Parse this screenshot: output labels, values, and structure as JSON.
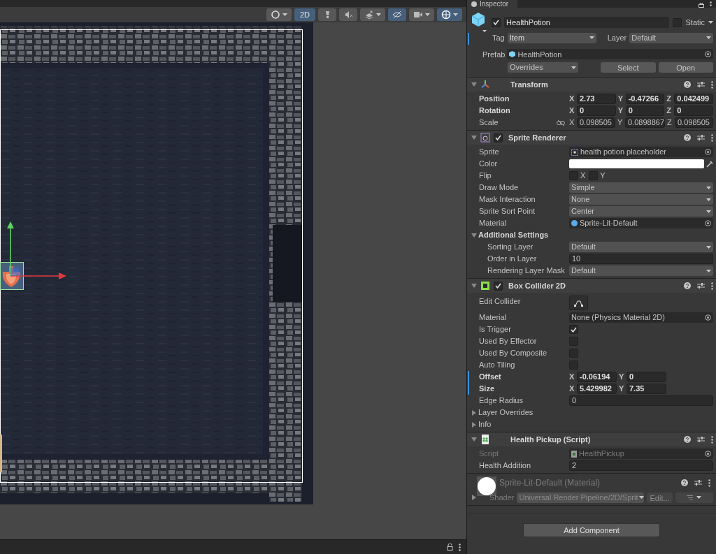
{
  "scene": {
    "toolbar": [
      {
        "kind": "shading",
        "selected": false,
        "dropdown": true
      },
      {
        "kind": "text",
        "label": "2D",
        "selected": true,
        "dropdown": false
      },
      {
        "kind": "lighting",
        "selected": false,
        "dropdown": false
      },
      {
        "kind": "audio",
        "selected": false,
        "dropdown": false
      },
      {
        "kind": "effects",
        "selected": false,
        "dropdown": true
      },
      {
        "kind": "visibility",
        "selected": true,
        "dropdown": false
      },
      {
        "kind": "camera",
        "selected": false,
        "dropdown": true
      },
      {
        "kind": "gizmos",
        "selected": true,
        "dropdown": true
      }
    ]
  },
  "inspector": {
    "tab": "Inspector",
    "object": {
      "active": true,
      "name": "HealthPotion",
      "static_label": "Static",
      "static": false,
      "tag_label": "Tag",
      "tag": "Item",
      "layer_label": "Layer",
      "layer": "Default",
      "prefab_label": "Prefab",
      "prefab": "HealthPotion",
      "overrides": "Overrides",
      "buttons": [
        "Select",
        "Open"
      ]
    },
    "components": [
      {
        "kind": "transform",
        "title": "Transform",
        "expanded": true,
        "properties": [
          {
            "kind": "vector",
            "label": "Position",
            "bold": true,
            "bar": false,
            "fields": [
              {
                "axis": "X",
                "value": "2.73"
              },
              {
                "axis": "Y",
                "value": "-0.47266"
              },
              {
                "axis": "Z",
                "value": "0.042499"
              }
            ]
          },
          {
            "kind": "vector",
            "label": "Rotation",
            "bold": true,
            "bar": false,
            "fields": [
              {
                "axis": "X",
                "value": "0"
              },
              {
                "axis": "Y",
                "value": "0"
              },
              {
                "axis": "Z",
                "value": "0"
              }
            ]
          },
          {
            "kind": "vector",
            "label": "Scale",
            "bold": false,
            "bar": false,
            "linked": true,
            "fields": [
              {
                "axis": "X",
                "value": "0.098505"
              },
              {
                "axis": "Y",
                "value": "0.0898867"
              },
              {
                "axis": "Z",
                "value": "0.098505"
              }
            ]
          }
        ]
      },
      {
        "kind": "sprite",
        "title": "Sprite Renderer",
        "enabled": true,
        "expanded": true,
        "properties": [
          {
            "kind": "sprite",
            "label": "Sprite",
            "value": "health potion placeholder"
          },
          {
            "kind": "color",
            "label": "Color"
          },
          {
            "kind": "flip",
            "label": "Flip",
            "checks": [
              {
                "axis": "X",
                "checked": false
              },
              {
                "axis": "Y",
                "checked": false
              }
            ]
          },
          {
            "kind": "dropdown",
            "label": "Draw Mode",
            "value": "Simple"
          },
          {
            "kind": "dropdown",
            "label": "Mask Interaction",
            "value": "None"
          },
          {
            "kind": "dropdown",
            "label": "Sprite Sort Point",
            "value": "Center"
          },
          {
            "kind": "material",
            "label": "Material",
            "value": "Sprite-Lit-Default"
          },
          {
            "kind": "foldout",
            "label": "Additional Settings",
            "expanded": true,
            "children": [
              {
                "kind": "dropdown",
                "label": "Sorting Layer",
                "value": "Default"
              },
              {
                "kind": "field",
                "label": "Order in Layer",
                "value": "10"
              },
              {
                "kind": "dropdown",
                "label": "Rendering Layer Mask",
                "value": "Default"
              }
            ]
          }
        ]
      },
      {
        "kind": "collider",
        "title": "Box Collider 2D",
        "enabled": true,
        "expanded": true,
        "properties": [
          {
            "kind": "button",
            "label": "Edit Collider"
          },
          {
            "kind": "object",
            "label": "Material",
            "value": "None (Physics Material 2D)"
          },
          {
            "kind": "checkbox",
            "label": "Is Trigger",
            "checked": true
          },
          {
            "kind": "checkbox",
            "label": "Used By Effector",
            "checked": false
          },
          {
            "kind": "checkbox",
            "label": "Used By Composite",
            "checked": false
          },
          {
            "kind": "checkbox",
            "label": "Auto Tiling",
            "checked": false
          },
          {
            "kind": "vector",
            "label": "Offset",
            "bold": true,
            "bar": true,
            "fields": [
              {
                "axis": "X",
                "value": "-0.06194"
              },
              {
                "axis": "Y",
                "value": "0"
              }
            ]
          },
          {
            "kind": "vector",
            "label": "Size",
            "bold": true,
            "bar": true,
            "fields": [
              {
                "axis": "X",
                "value": "5.429982"
              },
              {
                "axis": "Y",
                "value": "7.35"
              }
            ]
          },
          {
            "kind": "field",
            "label": "Edge Radius",
            "value": "0"
          },
          {
            "kind": "foldout",
            "label": "Layer Overrides",
            "expanded": false
          },
          {
            "kind": "foldout",
            "label": "Info",
            "expanded": false
          }
        ]
      },
      {
        "kind": "script",
        "title": "Health Pickup (Script)",
        "expanded": true,
        "properties": [
          {
            "kind": "script",
            "label": "Script",
            "value": "HealthPickup",
            "disabled": true
          },
          {
            "kind": "field",
            "label": "Health Addition",
            "value": "2"
          }
        ]
      }
    ],
    "material": {
      "title": "Sprite-Lit-Default (Material)",
      "shader_label": "Shader",
      "shader": "Universal Render Pipeline/2D/Sprit",
      "edit": "Edit..."
    },
    "add_component": "Add Component"
  }
}
